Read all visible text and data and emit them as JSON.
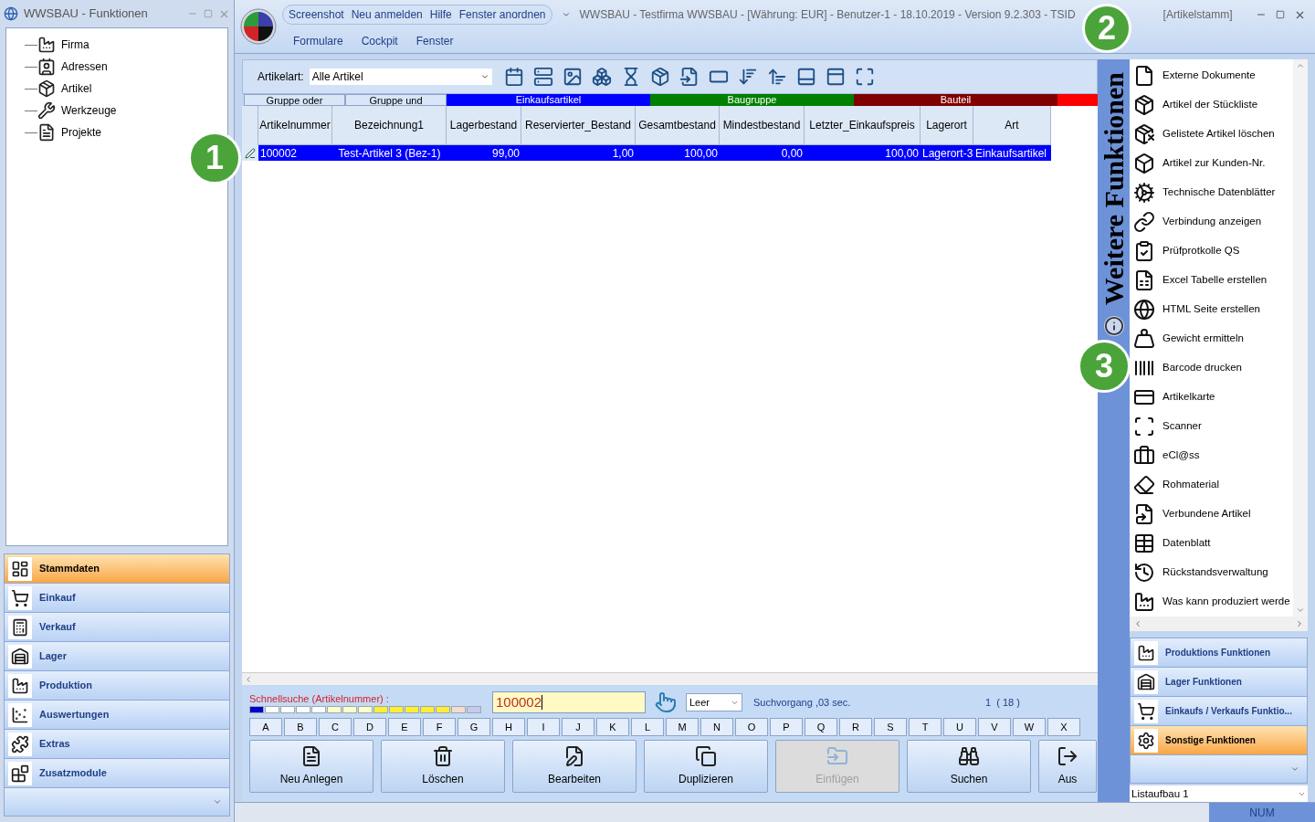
{
  "left_window": {
    "title": "WWSBAU - Funktionen",
    "tree": [
      "Firma",
      "Adressen",
      "Artikel",
      "Werkzeuge",
      "Projekte"
    ],
    "nav": [
      {
        "label": "Stammdaten",
        "selected": true
      },
      {
        "label": "Einkauf",
        "selected": false
      },
      {
        "label": "Verkauf",
        "selected": false
      },
      {
        "label": "Lager",
        "selected": false
      },
      {
        "label": "Produktion",
        "selected": false
      },
      {
        "label": "Auswertungen",
        "selected": false
      },
      {
        "label": "Extras",
        "selected": false
      },
      {
        "label": "Zusatzmodule",
        "selected": false
      }
    ]
  },
  "main_window": {
    "quick_access": [
      "Screenshot",
      "Neu anmelden",
      "Hilfe",
      "Fenster anordnen"
    ],
    "title": "WWSBAU - Testfirma WWSBAU - [Währung: EUR] - Benutzer-1 - 18.10.2019 - Version 9.2.303 - TSID",
    "title_suffix": "[Artikelstamm]",
    "menu": [
      "Formulare",
      "Cockpit",
      "Fenster"
    ]
  },
  "toolbar": {
    "artikelart_label": "Artikelart:",
    "artikelart_value": "Alle Artikel"
  },
  "groups": [
    {
      "label": "Gruppe oder",
      "kind": "button"
    },
    {
      "label": "Gruppe und",
      "kind": "button"
    },
    {
      "label": "Einkaufsartikel",
      "kind": "band",
      "color": "#0000ff"
    },
    {
      "label": "Baugruppe",
      "kind": "band",
      "color": "#008000"
    },
    {
      "label": "Bauteil",
      "kind": "band",
      "color": "#800000"
    },
    {
      "kind": "band",
      "color": "#ff0000"
    }
  ],
  "table": {
    "columns": [
      "Artikelnummer",
      "Bezeichnung1",
      "Lagerbestand",
      "Reservierter_Bestand",
      "Gesamtbestand",
      "Mindestbestand",
      "Letzter_Einkaufspreis",
      "Lagerort",
      "Art"
    ],
    "rows": [
      {
        "selected": true,
        "cells": [
          "100002",
          "Test-Artikel 3  (Bez-1)",
          "99,00",
          "1,00",
          "100,00",
          "0,00",
          "100,00",
          "Lagerort-3",
          "Einkaufsartikel"
        ]
      }
    ]
  },
  "quick_search": {
    "label": "Schnellsuche (Artikelnummer) :",
    "value": "100002",
    "mode": "Leer",
    "timing": "Suchvorgang ,03 sec.",
    "count": "1  ( 18 )"
  },
  "letters": [
    "A",
    "B",
    "C",
    "D",
    "E",
    "F",
    "G",
    "H",
    "I",
    "J",
    "K",
    "L",
    "M",
    "N",
    "O",
    "P",
    "Q",
    "R",
    "S",
    "T",
    "U",
    "V",
    "W",
    "X"
  ],
  "actions": [
    {
      "label": "Neu Anlegen",
      "disabled": false
    },
    {
      "label": "Löschen",
      "disabled": false
    },
    {
      "label": "Bearbeiten",
      "disabled": false
    },
    {
      "label": "Duplizieren",
      "disabled": false
    },
    {
      "label": "Einfügen",
      "disabled": true
    },
    {
      "label": "Suchen",
      "disabled": false
    },
    {
      "label": "Aus",
      "disabled": false
    }
  ],
  "right_panel": {
    "title": "Weitere Funktionen",
    "items": [
      "Externe Dokumente",
      "Artikel der Stückliste",
      "Gelistete Artikel löschen",
      "Artikel zur Kunden-Nr.",
      "Technische Datenblätter",
      "Verbindung anzeigen",
      "Prüfprotkolle QS",
      "Excel Tabelle erstellen",
      "HTML Seite erstellen",
      "Gewicht ermitteln",
      "Barcode drucken",
      "Artikelkarte",
      "Scanner",
      "eCl@ss",
      "Rohmaterial",
      "Verbundene Artikel",
      "Datenblatt",
      "Rückstandsverwaltung",
      "Was kann produziert werde"
    ],
    "nav": [
      {
        "label": "Produktions Funktionen",
        "selected": false
      },
      {
        "label": "Lager Funktionen",
        "selected": false
      },
      {
        "label": "Einkaufs / Verkaufs Funktio...",
        "selected": false
      },
      {
        "label": "Sonstige Funktionen",
        "selected": true
      }
    ],
    "layout_select": "Listaufbau 1"
  },
  "status_bar": {
    "indicator": "NUM"
  },
  "callouts": [
    "1",
    "2",
    "3"
  ]
}
